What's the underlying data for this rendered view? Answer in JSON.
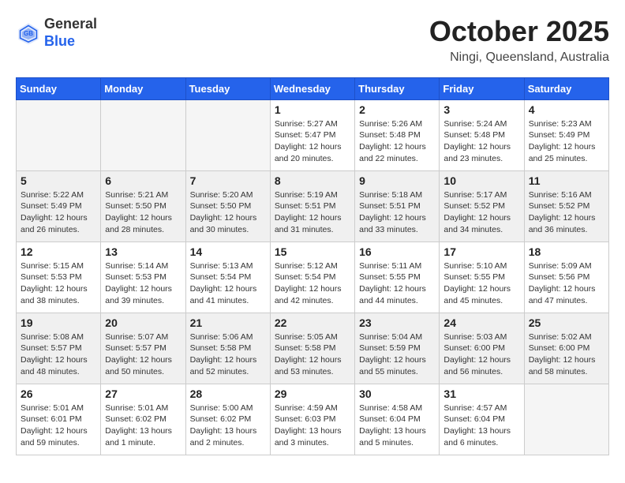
{
  "header": {
    "logo_general": "General",
    "logo_blue": "Blue",
    "month": "October 2025",
    "location": "Ningi, Queensland, Australia"
  },
  "weekdays": [
    "Sunday",
    "Monday",
    "Tuesday",
    "Wednesday",
    "Thursday",
    "Friday",
    "Saturday"
  ],
  "weeks": [
    [
      {
        "day": "",
        "info": ""
      },
      {
        "day": "",
        "info": ""
      },
      {
        "day": "",
        "info": ""
      },
      {
        "day": "1",
        "info": "Sunrise: 5:27 AM\nSunset: 5:47 PM\nDaylight: 12 hours\nand 20 minutes."
      },
      {
        "day": "2",
        "info": "Sunrise: 5:26 AM\nSunset: 5:48 PM\nDaylight: 12 hours\nand 22 minutes."
      },
      {
        "day": "3",
        "info": "Sunrise: 5:24 AM\nSunset: 5:48 PM\nDaylight: 12 hours\nand 23 minutes."
      },
      {
        "day": "4",
        "info": "Sunrise: 5:23 AM\nSunset: 5:49 PM\nDaylight: 12 hours\nand 25 minutes."
      }
    ],
    [
      {
        "day": "5",
        "info": "Sunrise: 5:22 AM\nSunset: 5:49 PM\nDaylight: 12 hours\nand 26 minutes."
      },
      {
        "day": "6",
        "info": "Sunrise: 5:21 AM\nSunset: 5:50 PM\nDaylight: 12 hours\nand 28 minutes."
      },
      {
        "day": "7",
        "info": "Sunrise: 5:20 AM\nSunset: 5:50 PM\nDaylight: 12 hours\nand 30 minutes."
      },
      {
        "day": "8",
        "info": "Sunrise: 5:19 AM\nSunset: 5:51 PM\nDaylight: 12 hours\nand 31 minutes."
      },
      {
        "day": "9",
        "info": "Sunrise: 5:18 AM\nSunset: 5:51 PM\nDaylight: 12 hours\nand 33 minutes."
      },
      {
        "day": "10",
        "info": "Sunrise: 5:17 AM\nSunset: 5:52 PM\nDaylight: 12 hours\nand 34 minutes."
      },
      {
        "day": "11",
        "info": "Sunrise: 5:16 AM\nSunset: 5:52 PM\nDaylight: 12 hours\nand 36 minutes."
      }
    ],
    [
      {
        "day": "12",
        "info": "Sunrise: 5:15 AM\nSunset: 5:53 PM\nDaylight: 12 hours\nand 38 minutes."
      },
      {
        "day": "13",
        "info": "Sunrise: 5:14 AM\nSunset: 5:53 PM\nDaylight: 12 hours\nand 39 minutes."
      },
      {
        "day": "14",
        "info": "Sunrise: 5:13 AM\nSunset: 5:54 PM\nDaylight: 12 hours\nand 41 minutes."
      },
      {
        "day": "15",
        "info": "Sunrise: 5:12 AM\nSunset: 5:54 PM\nDaylight: 12 hours\nand 42 minutes."
      },
      {
        "day": "16",
        "info": "Sunrise: 5:11 AM\nSunset: 5:55 PM\nDaylight: 12 hours\nand 44 minutes."
      },
      {
        "day": "17",
        "info": "Sunrise: 5:10 AM\nSunset: 5:55 PM\nDaylight: 12 hours\nand 45 minutes."
      },
      {
        "day": "18",
        "info": "Sunrise: 5:09 AM\nSunset: 5:56 PM\nDaylight: 12 hours\nand 47 minutes."
      }
    ],
    [
      {
        "day": "19",
        "info": "Sunrise: 5:08 AM\nSunset: 5:57 PM\nDaylight: 12 hours\nand 48 minutes."
      },
      {
        "day": "20",
        "info": "Sunrise: 5:07 AM\nSunset: 5:57 PM\nDaylight: 12 hours\nand 50 minutes."
      },
      {
        "day": "21",
        "info": "Sunrise: 5:06 AM\nSunset: 5:58 PM\nDaylight: 12 hours\nand 52 minutes."
      },
      {
        "day": "22",
        "info": "Sunrise: 5:05 AM\nSunset: 5:58 PM\nDaylight: 12 hours\nand 53 minutes."
      },
      {
        "day": "23",
        "info": "Sunrise: 5:04 AM\nSunset: 5:59 PM\nDaylight: 12 hours\nand 55 minutes."
      },
      {
        "day": "24",
        "info": "Sunrise: 5:03 AM\nSunset: 6:00 PM\nDaylight: 12 hours\nand 56 minutes."
      },
      {
        "day": "25",
        "info": "Sunrise: 5:02 AM\nSunset: 6:00 PM\nDaylight: 12 hours\nand 58 minutes."
      }
    ],
    [
      {
        "day": "26",
        "info": "Sunrise: 5:01 AM\nSunset: 6:01 PM\nDaylight: 12 hours\nand 59 minutes."
      },
      {
        "day": "27",
        "info": "Sunrise: 5:01 AM\nSunset: 6:02 PM\nDaylight: 13 hours\nand 1 minute."
      },
      {
        "day": "28",
        "info": "Sunrise: 5:00 AM\nSunset: 6:02 PM\nDaylight: 13 hours\nand 2 minutes."
      },
      {
        "day": "29",
        "info": "Sunrise: 4:59 AM\nSunset: 6:03 PM\nDaylight: 13 hours\nand 3 minutes."
      },
      {
        "day": "30",
        "info": "Sunrise: 4:58 AM\nSunset: 6:04 PM\nDaylight: 13 hours\nand 5 minutes."
      },
      {
        "day": "31",
        "info": "Sunrise: 4:57 AM\nSunset: 6:04 PM\nDaylight: 13 hours\nand 6 minutes."
      },
      {
        "day": "",
        "info": ""
      }
    ]
  ]
}
